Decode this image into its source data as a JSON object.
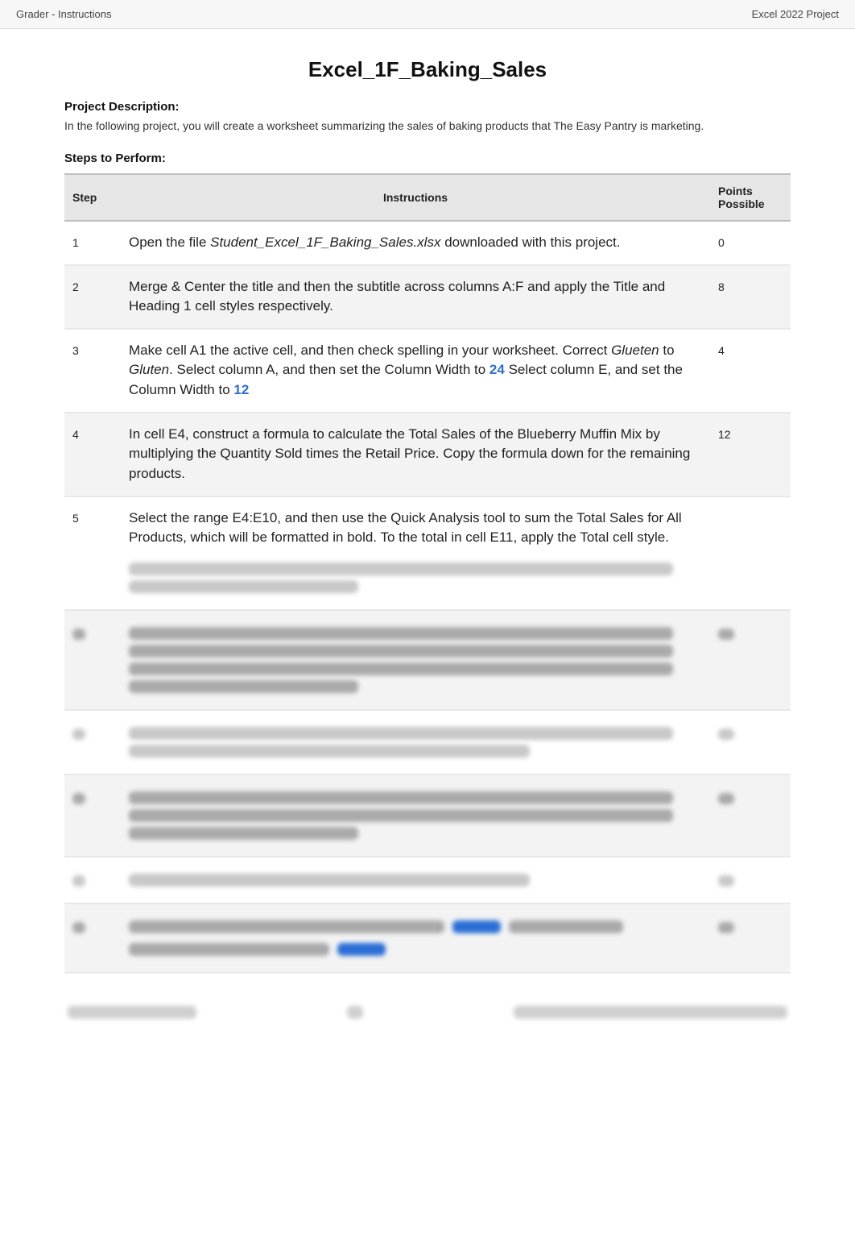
{
  "header": {
    "left": "Grader - Instructions",
    "right": "Excel 2022 Project"
  },
  "title": "Excel_1F_Baking_Sales",
  "project_description_heading": "Project Description:",
  "project_description": "In the following project, you will create a worksheet summarizing the sales of baking products that The Easy Pantry is marketing.",
  "steps_heading": "Steps to Perform:",
  "table": {
    "columns": {
      "step": "Step",
      "instructions": "Instructions",
      "points": "Points Possible"
    },
    "rows": [
      {
        "step": "1",
        "instr_pre": "Open the file ",
        "instr_file": "Student_Excel_1F_Baking_Sales.xlsx",
        "instr_post": " downloaded with this project.",
        "points": "0"
      },
      {
        "step": "2",
        "instr": "Merge & Center the title and then the subtitle across columns A:F and apply the Title and Heading 1 cell styles respectively.",
        "points": "8"
      },
      {
        "step": "3",
        "instr_a": "Make cell A1 the active cell, and then check spelling in your worksheet. Correct ",
        "instr_it1": "Glueten",
        "instr_b": " to ",
        "instr_it2": "Gluten",
        "instr_c": ". Select column A, and then set the Column Width to ",
        "num1": "24",
        "instr_d": " Select column E, and set the Column Width to ",
        "num2": "12",
        "points": "4"
      },
      {
        "step": "4",
        "instr": "In cell E4, construct a formula to calculate the Total Sales of the Blueberry Muffin Mix by multiplying the Quantity Sold times the Retail Price. Copy the formula down for the remaining products.",
        "points": "12"
      },
      {
        "step": "5",
        "instr": "Select the range E4:E10, and then use the Quick Analysis tool to sum the Total Sales for All Products, which will be formatted in bold. To the total in cell E11, apply the Total cell style.",
        "points": ""
      }
    ]
  }
}
